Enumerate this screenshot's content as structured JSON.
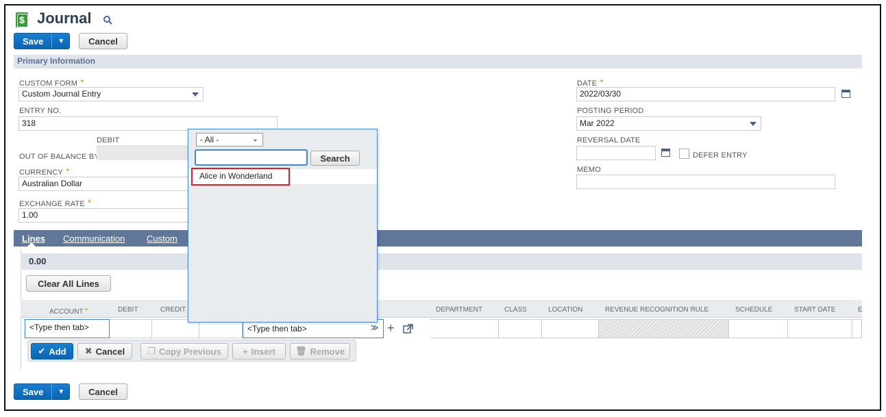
{
  "header": {
    "title": "Journal",
    "save_label": "Save",
    "cancel_label": "Cancel"
  },
  "primary_section": {
    "title": "Primary Information",
    "custom_form": {
      "label": "CUSTOM FORM",
      "value": "Custom Journal Entry"
    },
    "entry_no": {
      "label": "ENTRY NO.",
      "value": "318"
    },
    "debit_label": "DEBIT",
    "out_of_balance_label": "OUT OF BALANCE BY",
    "currency": {
      "label": "CURRENCY",
      "value": "Australian Dollar"
    },
    "exchange_rate": {
      "label": "EXCHANGE RATE",
      "value": "1.00"
    },
    "date": {
      "label": "DATE",
      "value": "2022/03/30"
    },
    "posting_period": {
      "label": "POSTING PERIOD",
      "value": "Mar 2022"
    },
    "reversal_date": {
      "label": "REVERSAL DATE",
      "value": ""
    },
    "defer_entry_label": "DEFER ENTRY",
    "memo": {
      "label": "MEMO",
      "value": ""
    }
  },
  "tabs": [
    {
      "label": "Lines"
    },
    {
      "label": "Communication"
    },
    {
      "label": "Custom"
    }
  ],
  "lines": {
    "total": "0.00",
    "clear_all_label": "Clear All Lines",
    "columns": [
      "ACCOUNT",
      "DEBIT",
      "CREDIT",
      "DEPARTMENT",
      "CLASS",
      "LOCATION",
      "REVENUE RECOGNITION RULE",
      "SCHEDULE",
      "START DATE",
      "E"
    ],
    "account_placeholder": "<Type then tab>",
    "name_placeholder": "<Type then tab>",
    "toolbar": {
      "add": "Add",
      "cancel": "Cancel",
      "copy_previous": "Copy Previous",
      "insert": "Insert",
      "remove": "Remove"
    }
  },
  "popup": {
    "filter_value": "- All -",
    "search_value": "",
    "search_button": "Search",
    "results": [
      "Alice in Wonderland"
    ]
  },
  "footer": {
    "save_label": "Save",
    "cancel_label": "Cancel"
  },
  "colors": {
    "accent_blue": "#0b64b0",
    "tab_bar": "#607799",
    "section_bar": "#dfe4ec",
    "required": "#e0a000",
    "highlight_red": "#d42030"
  }
}
